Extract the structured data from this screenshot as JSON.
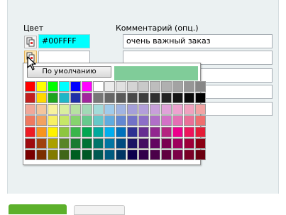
{
  "form": {
    "color_label": "Цвет",
    "comment_label": "Комментарий (опц.)",
    "rows": [
      {
        "color_value": "#00FFFF",
        "color_fill": "#00ffff",
        "comment_value": "очень важный заказ",
        "icon_active": false
      },
      {
        "color_value": "",
        "color_fill": "#ffffff",
        "comment_value": "",
        "icon_active": true
      },
      {
        "color_value": "",
        "color_fill": "#ffffff",
        "comment_value": "",
        "icon_active": false
      },
      {
        "color_value": "",
        "color_fill": "#ffffff",
        "comment_value": "",
        "icon_active": false
      },
      {
        "color_value": "",
        "color_fill": "#ffffff",
        "comment_value": "",
        "icon_active": false
      }
    ]
  },
  "color_picker": {
    "default_button_label": "По умолчанию",
    "preview_color": "#80cc99",
    "palette": [
      [
        "#ff0000",
        "#ffff00",
        "#00ff00",
        "#00ffff",
        "#0000ff",
        "#ff00ff",
        "#ffffff",
        "#ebebeb",
        "#e0e0e0",
        "#d4d4d4",
        "#c9c9c9",
        "#bdbdbd",
        "#b0b0b0",
        "#a3a3a3",
        "#969696",
        "#878787"
      ],
      [
        "#c21e1e",
        "#ffd800",
        "#1ea51e",
        "#20b6c7",
        "#1f2fa8",
        "#a1269c",
        "#767676",
        "#666666",
        "#595959",
        "#4a4a4a",
        "#3d3d3d",
        "#303030",
        "#222222",
        "#151515",
        "#0a0a0a",
        "#000000"
      ],
      [
        "#f0a89a",
        "#f4c59c",
        "#f7f29f",
        "#d9ee9f",
        "#b7e1a1",
        "#a2d9b6",
        "#a3dbd9",
        "#a0cbeb",
        "#a1b4e2",
        "#a59fd9",
        "#b39fda",
        "#c8a0da",
        "#e0a2d9",
        "#eda2cf",
        "#f0a2bf",
        "#f2a4a4"
      ],
      [
        "#ef7960",
        "#f2a160",
        "#f7f064",
        "#c6e767",
        "#86d36d",
        "#65c98d",
        "#64c8c8",
        "#60acdf",
        "#6388d2",
        "#7272c7",
        "#8c6ec7",
        "#b06fc8",
        "#d370c7",
        "#e46fb4",
        "#ea6f97",
        "#ef6f6f"
      ],
      [
        "#ed1c24",
        "#f7941d",
        "#fff200",
        "#8dc63f",
        "#39b54a",
        "#00a651",
        "#00a99d",
        "#00aeef",
        "#0072bc",
        "#2e3192",
        "#662d91",
        "#92278f",
        "#b4237f",
        "#ec008c",
        "#ed145b",
        "#e31c36"
      ],
      [
        "#9e0b0f",
        "#a0410d",
        "#aba000",
        "#598527",
        "#197b30",
        "#007236",
        "#00746b",
        "#0076a3",
        "#004b80",
        "#1b1464",
        "#440e62",
        "#630460",
        "#7a0050",
        "#9e005d",
        "#9e0039",
        "#8a0013"
      ],
      [
        "#790000",
        "#7b2e00",
        "#827b00",
        "#406618",
        "#005e20",
        "#005826",
        "#005952",
        "#005b7f",
        "#003663",
        "#0d004c",
        "#32004b",
        "#4b0049",
        "#600040",
        "#7b0046",
        "#7a0026",
        "#6a0010"
      ]
    ]
  }
}
